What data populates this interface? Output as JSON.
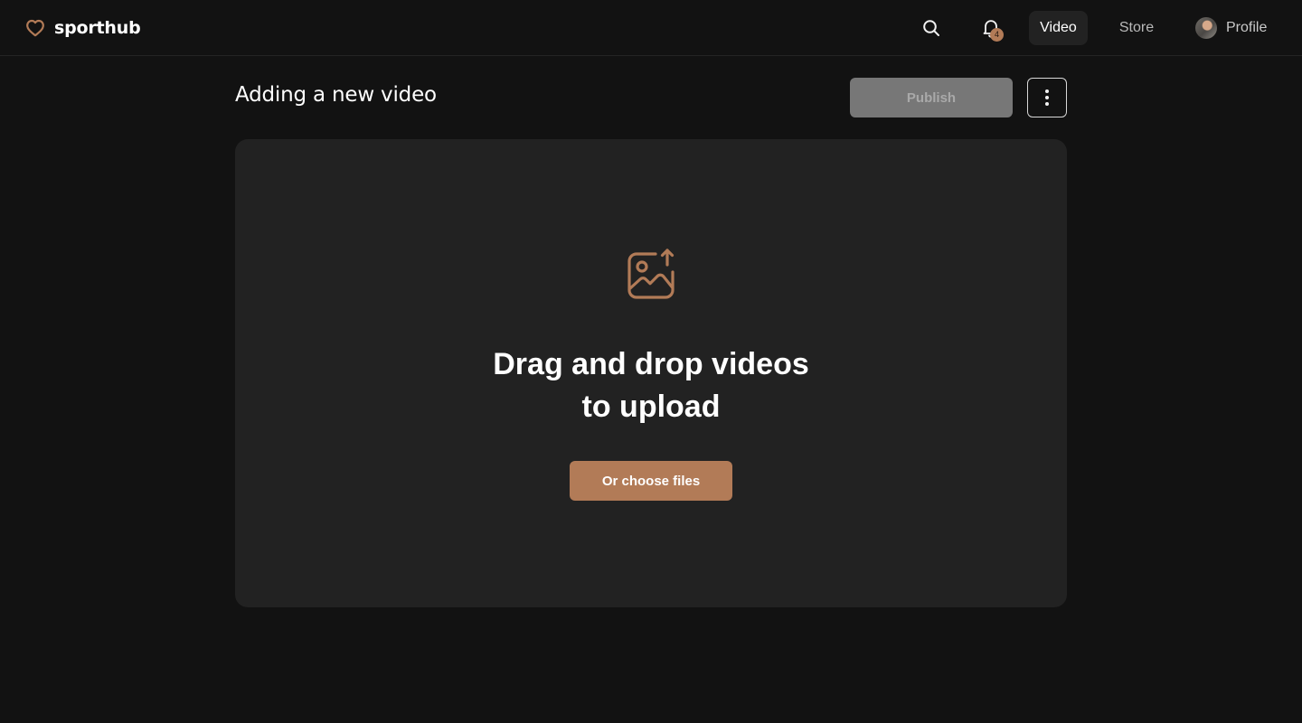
{
  "app": {
    "brand_name": "sporthub",
    "logo_icon": "heart-icon",
    "accent_color": "#b27b57"
  },
  "header": {
    "search_icon": "search-icon",
    "notifications": {
      "icon": "bell-icon",
      "count": "4"
    },
    "tabs": [
      {
        "label": "Video",
        "active": true
      },
      {
        "label": "Store",
        "active": false
      }
    ],
    "profile": {
      "label": "Profile",
      "avatar": "user-avatar"
    }
  },
  "page": {
    "title": "Adding a new video",
    "publish_label": "Publish",
    "publish_disabled": true,
    "more_icon": "vertical-dots-icon"
  },
  "upload": {
    "icon": "image-upload-icon",
    "title_line1": "Drag and drop videos",
    "title_line2": "to upload",
    "choose_label": "Or choose files"
  }
}
